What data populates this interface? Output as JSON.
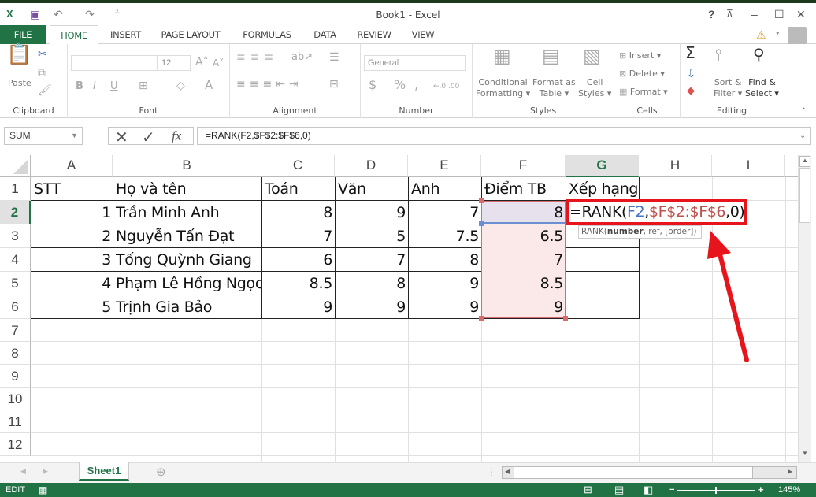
{
  "window": {
    "title": "Book1 - Excel"
  },
  "quick_access": {
    "app_icon": "excel-icon",
    "save": "save-icon",
    "undo": "undo-icon",
    "redo": "redo-icon",
    "customize": "customize-icon"
  },
  "window_controls": {
    "help": "?",
    "ribbon_display": "ribbon-display-icon",
    "minimize": "–",
    "maximize": "☐",
    "close": "✕"
  },
  "tabs": [
    {
      "label": "FILE"
    },
    {
      "label": "HOME"
    },
    {
      "label": "INSERT"
    },
    {
      "label": "PAGE LAYOUT"
    },
    {
      "label": "FORMULAS"
    },
    {
      "label": "DATA"
    },
    {
      "label": "REVIEW"
    },
    {
      "label": "VIEW"
    }
  ],
  "ribbon": {
    "clipboard": {
      "label": "Clipboard",
      "paste": "Paste"
    },
    "font": {
      "label": "Font",
      "font_name": "",
      "font_size": "12",
      "bold": "B",
      "italic": "I",
      "underline": "U",
      "font_color": "A"
    },
    "alignment": {
      "label": "Alignment"
    },
    "number": {
      "label": "Number",
      "format": "General",
      "currency": "$",
      "percent": "%",
      "comma": ","
    },
    "styles": {
      "label": "Styles",
      "conditional": "Conditional",
      "conditional2": "Formatting ▾",
      "format_table": "Format as",
      "format_table2": "Table ▾",
      "cell_styles": "Cell",
      "cell_styles2": "Styles ▾"
    },
    "cells": {
      "label": "Cells",
      "insert": "Insert ▾",
      "delete": "Delete ▾",
      "format": "Format ▾"
    },
    "editing": {
      "label": "Editing",
      "sort": "Sort &",
      "sort2": "Filter ▾",
      "find": "Find &",
      "find2": "Select ▾",
      "sum": "Σ"
    }
  },
  "formula_bar": {
    "name_box": "SUM",
    "formula": "=RANK(F2,$F$2:$F$6,0)",
    "cancel": "✕",
    "enter": "✓",
    "fx": "fx"
  },
  "columns": [
    "A",
    "B",
    "C",
    "D",
    "E",
    "F",
    "G",
    "H",
    "I"
  ],
  "rows": [
    "1",
    "2",
    "3",
    "4",
    "5",
    "6",
    "7",
    "8",
    "9",
    "10",
    "11",
    "12"
  ],
  "table": {
    "headers": [
      "STT",
      "Họ và tên",
      "Toán",
      "Văn",
      "Anh",
      "Điểm TB",
      "Xếp hạng"
    ],
    "rows": [
      [
        "1",
        "Trần Minh Anh",
        "8",
        "9",
        "7",
        "8"
      ],
      [
        "2",
        "Nguyễn Tấn Đạt",
        "7",
        "5",
        "7.5",
        "6.5"
      ],
      [
        "3",
        "Tống Quỳnh Giang",
        "6",
        "7",
        "8",
        "7"
      ],
      [
        "4",
        "Phạm Lê Hồng Ngọc",
        "8.5",
        "8",
        "9",
        "8.5"
      ],
      [
        "5",
        "Trịnh Gia Bảo",
        "9",
        "9",
        "9",
        "9"
      ]
    ]
  },
  "edit_cell": {
    "prefix": "=RANK(",
    "arg1": "F2",
    "sep": ",",
    "arg2": "$F$2:$F$6",
    "suffix": ",0)"
  },
  "tooltip": {
    "fn": "RANK(",
    "bold": "number",
    "rest": ", ref, [order])"
  },
  "colors": {
    "accent": "#217346",
    "highlight_red": "#e8141b",
    "ref_blue": "#4472c4",
    "ref_red": "#c0504d"
  },
  "sheets": [
    {
      "label": "Sheet1"
    }
  ],
  "status": {
    "mode": "EDIT",
    "zoom": "145%"
  }
}
